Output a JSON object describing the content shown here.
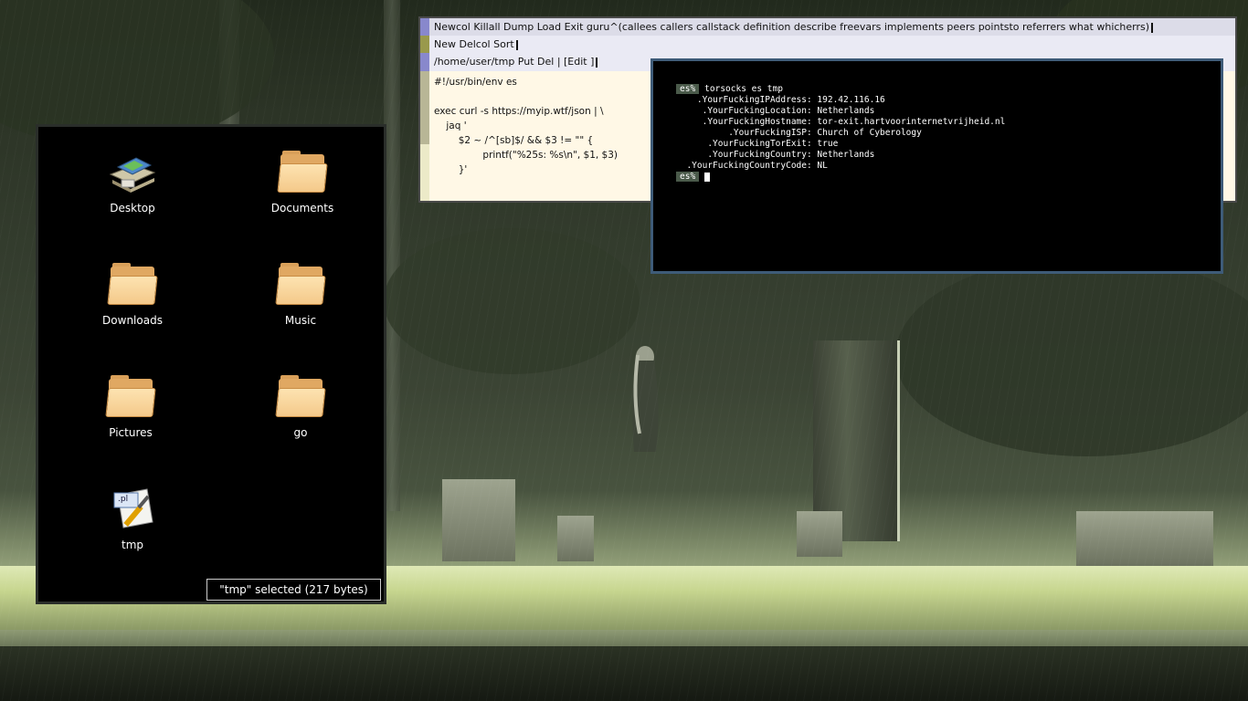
{
  "acme": {
    "column_tag": "Newcol Killall Dump Load Exit  guru^(callees callers callstack definition describe freevars implements peers pointsto referrers what whicherrs)",
    "window_tag": "New Delcol Sort",
    "file_tag": "/home/user/tmp  Put Del | [Edit ]",
    "body_lines": [
      "#!/usr/bin/env es",
      "",
      "exec curl -s https://myip.wtf/json | \\",
      "    jaq '",
      "        $2 ~ /^[sb]$/ && $3 != \"\" {",
      "                printf(\"%25s: %s\\n\", $1, $3)",
      "        }'"
    ]
  },
  "terminal": {
    "prompt": "es%",
    "command": "torsocks es tmp",
    "output": [
      "    .YourFuckingIPAddress: 192.42.116.16",
      "     .YourFuckingLocation: Netherlands",
      "     .YourFuckingHostname: tor-exit.hartvoorinternetvrijheid.nl",
      "          .YourFuckingISP: Church of Cyberology",
      "      .YourFuckingTorExit: true",
      "      .YourFuckingCountry: Netherlands",
      "  .YourFuckingCountryCode: NL"
    ]
  },
  "file_manager": {
    "items": [
      {
        "label": "Desktop",
        "icon": "desktop-icon"
      },
      {
        "label": "Documents",
        "icon": "folder-icon"
      },
      {
        "label": "Downloads",
        "icon": "folder-icon"
      },
      {
        "label": "Music",
        "icon": "folder-icon"
      },
      {
        "label": "Pictures",
        "icon": "folder-icon"
      },
      {
        "label": "go",
        "icon": "folder-icon"
      },
      {
        "label": "tmp",
        "icon": "perl-script-icon"
      }
    ],
    "status": "\"tmp\" selected (217 bytes)",
    "perl_badge": ".pl"
  }
}
